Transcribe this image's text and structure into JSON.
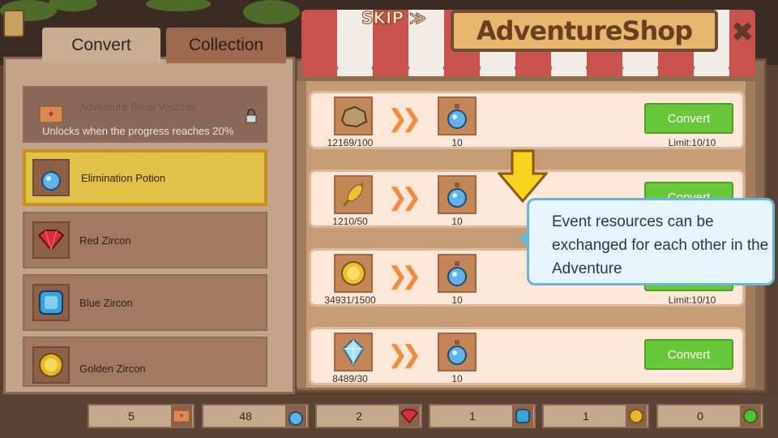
{
  "header": {
    "skip_label": "SKIP ≫",
    "title": "AdventureShop",
    "close_label": "✖"
  },
  "tabs": [
    {
      "label": "Convert",
      "active": true
    },
    {
      "label": "Collection",
      "active": false
    }
  ],
  "items": [
    {
      "label": "Adventure Shop Voucher",
      "sublabel": "Unlocks when the progress reaches 20%",
      "locked": true,
      "icon": "voucher-icon"
    },
    {
      "label": "Elimination Potion",
      "selected": true,
      "icon": "potion-icon"
    },
    {
      "label": "Red Zircon",
      "icon": "red-zircon-icon"
    },
    {
      "label": "Blue Zircon",
      "icon": "blue-zircon-icon"
    },
    {
      "label": "Golden Zircon",
      "icon": "golden-zircon-icon"
    }
  ],
  "conversions": [
    {
      "resource_icon": "rock-icon",
      "resource_count": "12169/100",
      "output_icon": "potion-icon",
      "output_count": "10",
      "button": "Convert",
      "limit": "Limit:10/10"
    },
    {
      "resource_icon": "wheat-icon",
      "resource_count": "1210/50",
      "output_icon": "potion-icon",
      "output_count": "10",
      "button": "Convert",
      "limit": ""
    },
    {
      "resource_icon": "coin-icon",
      "resource_count": "34931/1500",
      "output_icon": "potion-icon",
      "output_count": "10",
      "button": "Convert",
      "limit": "Limit:10/10"
    },
    {
      "resource_icon": "crystal-icon",
      "resource_count": "8489/30",
      "output_icon": "potion-icon",
      "output_count": "10",
      "button": "Convert",
      "limit": ""
    }
  ],
  "tooltip": {
    "text": "Event resources can be exchanged for each other in the Adventure"
  },
  "bottom_resources": [
    {
      "value": "5",
      "icon": "voucher-icon"
    },
    {
      "value": "48",
      "icon": "potion-icon"
    },
    {
      "value": "2",
      "icon": "red-zircon-icon"
    },
    {
      "value": "1",
      "icon": "blue-zircon-icon"
    },
    {
      "value": "1",
      "icon": "golden-zircon-icon"
    },
    {
      "value": "0",
      "icon": "green-orb-icon"
    }
  ],
  "colors": {
    "convert_button": "#69c73a",
    "selected_item": "#e3c24a",
    "awning_red": "#c9524c",
    "tooltip_border": "#66b6da"
  }
}
